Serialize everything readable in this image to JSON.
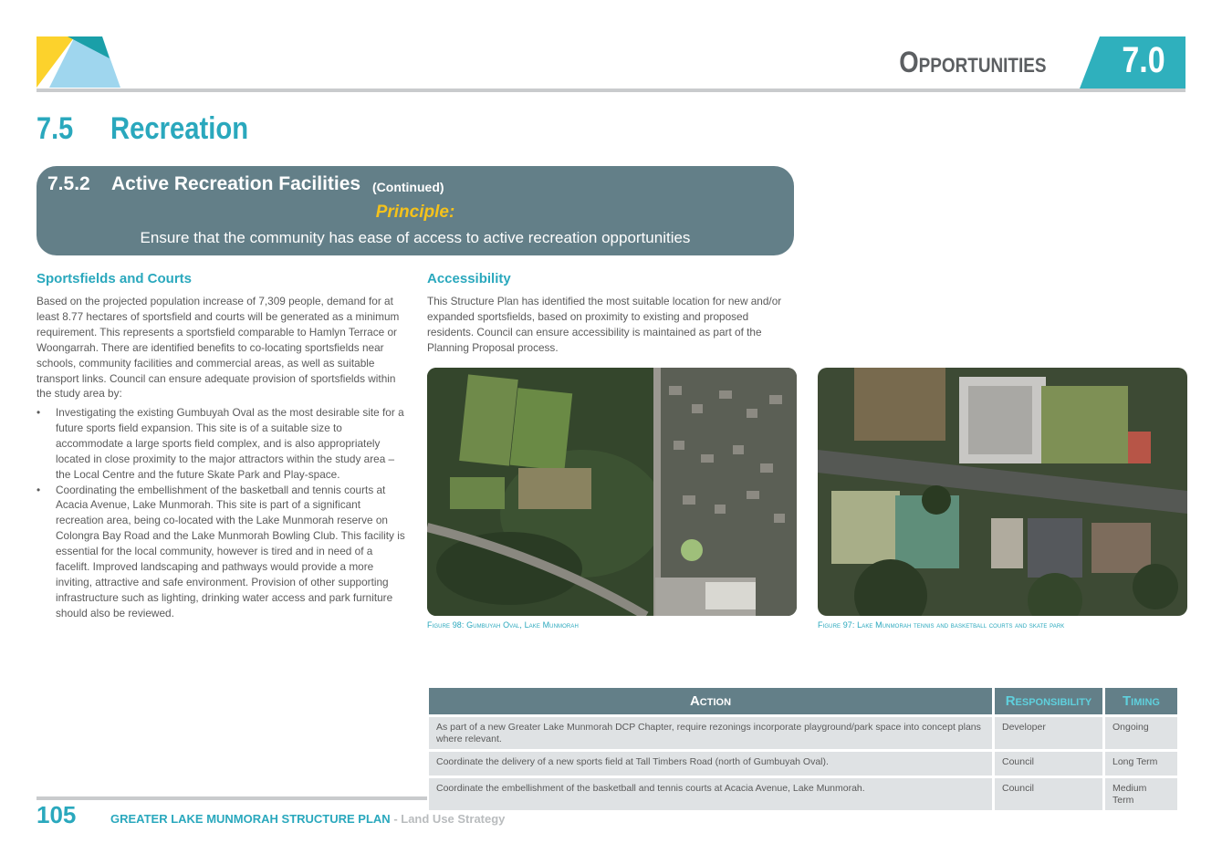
{
  "header": {
    "section_title": "Opportunities",
    "section_number": "7.0"
  },
  "page": {
    "heading_number": "7.5",
    "heading_text": "Recreation"
  },
  "principle_box": {
    "sub_number": "7.5.2",
    "sub_title": "Active Recreation Facilities",
    "continued": "(Continued)",
    "principle_label": "Principle:",
    "principle_text": "Ensure that the community has ease of access to active recreation opportunities"
  },
  "left_column": {
    "heading": "Sportsfields and Courts",
    "paragraph": "Based on the projected population increase of 7,309 people, demand for at least 8.77 hectares of sportsfield and courts will be generated as a minimum requirement. This represents a sportsfield comparable to Hamlyn Terrace or Woongarrah. There are identified benefits to co-locating sportsfields near schools, community facilities and commercial areas, as well as suitable transport links. Council can ensure adequate provision of sportsfields within the study area by:",
    "bullets": [
      "Investigating the existing Gumbuyah Oval as the most desirable site for a future sports field expansion. This site is of a suitable size to accommodate a large sports field complex, and is also appropriately located in close proximity to the major attractors within the study area – the Local Centre and the future Skate Park and Play-space.",
      "Coordinating the embellishment of the basketball and tennis courts at Acacia Avenue, Lake Munmorah. This site is part of a significant recreation area, being co-located with the Lake Munmorah reserve on Colongra Bay Road and the Lake Munmorah Bowling Club.  This facility is essential for the local community, however is tired and in need of a facelift. Improved landscaping and pathways would provide a more inviting, attractive and safe environment. Provision of other supporting infrastructure such as lighting, drinking water access and park furniture should also be reviewed."
    ]
  },
  "right_column": {
    "heading": "Accessibility",
    "paragraph": "This Structure Plan has identified the most suitable location for new and/or expanded sportsfields, based on proximity to existing and proposed residents. Council can ensure accessibility is maintained as part of the Planning Proposal process."
  },
  "figures": [
    {
      "caption": "Figure 98: Gumbuyah Oval, Lake Munmorah"
    },
    {
      "caption": "Figure 97: Lake Munmorah tennis and basketball courts and skate park"
    }
  ],
  "table": {
    "headers": [
      "Action",
      "Responsibility",
      "Timing"
    ],
    "rows": [
      [
        "As part of a new Greater Lake Munmorah DCP Chapter, require rezonings incorporate playground/park space into concept plans where relevant.",
        "Developer",
        "Ongoing"
      ],
      [
        "Coordinate the delivery of a new sports field at Tall Timbers Road (north of Gumbuyah Oval).",
        "Council",
        "Long Term"
      ],
      [
        "Coordinate the embellishment of the basketball and tennis courts at Acacia Avenue, Lake Munmorah.",
        "Council",
        "Medium Term"
      ]
    ]
  },
  "footer": {
    "page_number": "105",
    "title": "GREATER LAKE MUNMORAH STRUCTURE PLAN",
    "separator": " - ",
    "subtitle": "Land Use Strategy"
  },
  "colors": {
    "accent": "#2aa8bd",
    "panel": "#637f88",
    "principle": "#f5c21b",
    "logo_yellow": "#fcd22c",
    "logo_blue": "#9fd6ee",
    "logo_teal": "#1a9fa8"
  }
}
